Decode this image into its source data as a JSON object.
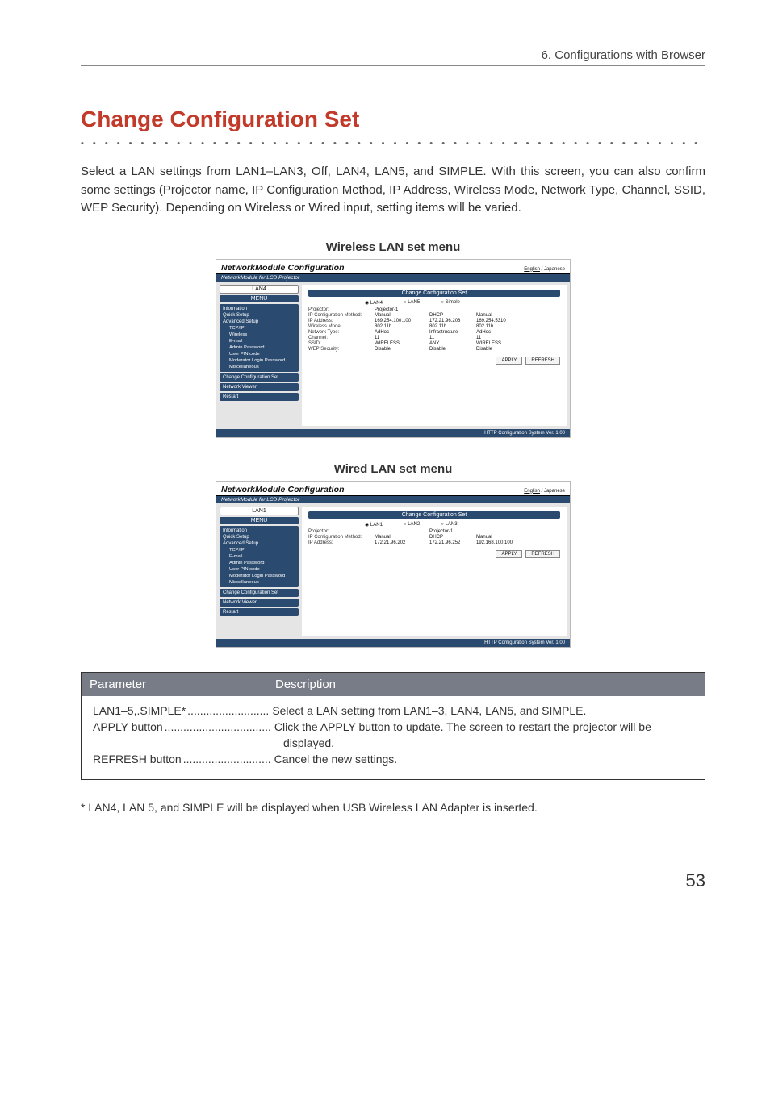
{
  "chapter": {
    "header": "6. Configurations with Browser"
  },
  "title": "Change Configuration Set",
  "intro": "Select a LAN settings from LAN1–LAN3, Off, LAN4, LAN5, and SIMPLE. With this screen, you can also confirm some settings (Projector name, IP Configuration Method, IP Address, Wireless Mode, Network Type, Channel, SSID, WEP Security). Depending on Wireless or Wired input, setting items will be varied.",
  "captions": {
    "wireless": "Wireless LAN set menu",
    "wired": "Wired LAN set menu"
  },
  "panel": {
    "title": "NetworkModule Configuration",
    "subtitle": "NetworkModule for LCD Projector",
    "lang": {
      "english": "English",
      "japanese": "Japanese"
    },
    "footer": "HTTP Configuration System Ver. 1.00",
    "sidebar": {
      "menu_label": "MENU",
      "lan_badge_wireless": "LAN4",
      "lan_badge_wired": "LAN1",
      "items": {
        "information": "Information",
        "quick_setup": "Quick Setup",
        "advanced_setup": "Advanced Setup",
        "tcpip": "TCP/IP",
        "wireless": "Wireless",
        "email": "E-mail",
        "admin_password": "Admin Password",
        "user_pin": "User PIN code",
        "moderator": "Moderator Login Password",
        "misc": "Miscellaneous",
        "change_config": "Change Configuration Set",
        "network_viewer": "Network Viewer",
        "restart": "Restart"
      }
    },
    "main": {
      "heading": "Change Configuration Set",
      "radios_wireless": {
        "a": "LAN4",
        "b": "LAN5",
        "c": "Simple"
      },
      "radios_wired": {
        "a": "LAN1",
        "b": "LAN2",
        "c": "LAN3"
      },
      "labels": {
        "projector": "Projector:",
        "ipcfg": "IP Configuration Method:",
        "ip": "IP Address:",
        "wmode": "Wireless Mode:",
        "ntype": "Network Type:",
        "channel": "Channel:",
        "ssid": "SSID:",
        "wep": "WEP Security:"
      },
      "wireless": {
        "c1": {
          "projector": "Projector-1",
          "ipcfg": "Manual",
          "ip": "169.254.100.100",
          "wmode": "802.11b",
          "ntype": "AdHoc",
          "channel": "11",
          "ssid": "WIRELESS",
          "wep": "Disable"
        },
        "c2": {
          "projector": "",
          "ipcfg": "DHCP",
          "ip": "172.21.96.208",
          "wmode": "802.11b",
          "ntype": "Infrastructure",
          "channel": "11",
          "ssid": "ANY",
          "wep": "Disable"
        },
        "c3": {
          "projector": "",
          "ipcfg": "Manual",
          "ip": "169.254.5310",
          "wmode": "802.11b",
          "ntype": "AdHoc",
          "channel": "11",
          "ssid": "WIRELESS",
          "wep": "Disable"
        }
      },
      "wired": {
        "c1": {
          "projector": "",
          "ipcfg": "Manual",
          "ip": "172.21.96.202"
        },
        "c2": {
          "projector": "Projector-1",
          "ipcfg": "DHCP",
          "ip": "172.21.96.252"
        },
        "c3": {
          "projector": "",
          "ipcfg": "Manual",
          "ip": "192.168.100.100"
        }
      },
      "buttons": {
        "apply": "APPLY",
        "refresh": "REFRESH"
      }
    }
  },
  "param_table": {
    "head": {
      "param": "Parameter",
      "desc": "Description"
    },
    "rows": {
      "r1": {
        "k": "LAN1–5,.SIMPLE*",
        "dots": " ..........................",
        "v": "Select a LAN setting from LAN1–3, LAN4, LAN5, and SIMPLE."
      },
      "r2": {
        "k": "APPLY button",
        "dots": "..................................",
        "v1": "Click the APPLY button to update. The screen to restart the projector will be",
        "v2": "displayed."
      },
      "r3": {
        "k": "REFRESH button",
        "dots": " ............................",
        "v": "Cancel the new settings."
      }
    }
  },
  "footnote": "* LAN4, LAN 5, and SIMPLE will be displayed when USB Wireless LAN Adapter is inserted.",
  "page_number": "53"
}
